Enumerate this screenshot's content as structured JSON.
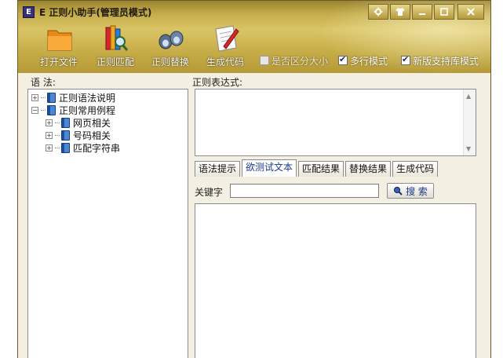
{
  "window": {
    "title": "E 正则小助手(管理员模式)",
    "app_icon_letter": "E"
  },
  "toolbar": {
    "buttons": [
      {
        "label": "打开文件",
        "icon": "folder-icon"
      },
      {
        "label": "正则匹配",
        "icon": "books-magnifier-icon"
      },
      {
        "label": "正则替换",
        "icon": "binoculars-icon"
      },
      {
        "label": "生成代码",
        "icon": "document-pen-icon"
      }
    ],
    "checkboxes": [
      {
        "label": "是否区分大小",
        "checked": false
      },
      {
        "label": "多行模式",
        "checked": true
      },
      {
        "label": "新版支持库模式",
        "checked": true
      }
    ]
  },
  "syntax_panel": {
    "label": "语 法:",
    "tree": [
      {
        "label": "正则语法说明",
        "toggle": "+",
        "level": 0
      },
      {
        "label": "正则常用例程",
        "toggle": "−",
        "level": 0
      },
      {
        "label": "网页相关",
        "toggle": "+",
        "level": 1
      },
      {
        "label": "号码相关",
        "toggle": "+",
        "level": 1
      },
      {
        "label": "匹配字符串",
        "toggle": "+",
        "level": 1
      }
    ]
  },
  "regex_panel": {
    "label": "正则表达式:",
    "value": ""
  },
  "tabs": [
    {
      "label": "语法提示",
      "active": false
    },
    {
      "label": "欲测试文本",
      "active": true
    },
    {
      "label": "匹配结果",
      "active": false
    },
    {
      "label": "替换结果",
      "active": false
    },
    {
      "label": "生成代码",
      "active": false
    }
  ],
  "search": {
    "keyword_label": "关键字",
    "keyword_value": "",
    "button_label": "搜 索"
  },
  "colors": {
    "chrome_gold": "#c7ad48",
    "active_tab_text": "#1a3a8a"
  }
}
